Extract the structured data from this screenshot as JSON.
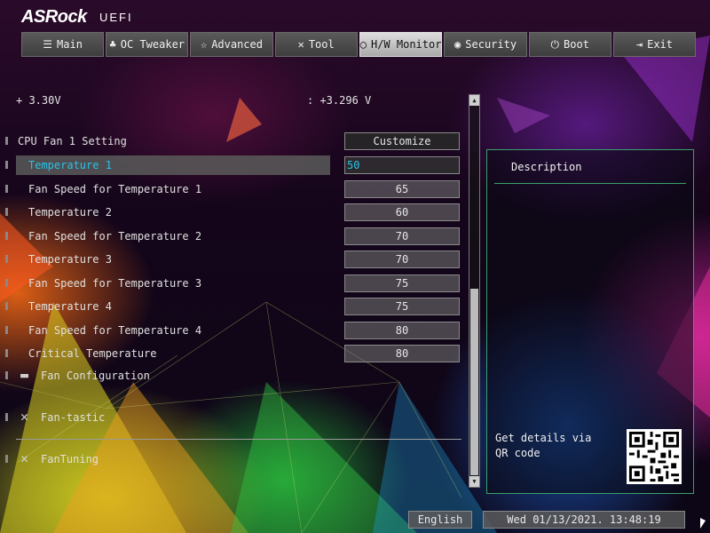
{
  "brand": {
    "logo": "ASRock",
    "tag": "UEFI"
  },
  "tabs": [
    {
      "label": "Main",
      "icon": "list-icon",
      "glyph": "☰"
    },
    {
      "label": "OC Tweaker",
      "icon": "rocket-icon",
      "glyph": "♣"
    },
    {
      "label": "Advanced",
      "icon": "star-icon",
      "glyph": "☆"
    },
    {
      "label": "Tool",
      "icon": "tools-icon",
      "glyph": "✕"
    },
    {
      "label": "H/W Monitor",
      "icon": "monitor-icon",
      "glyph": "◯"
    },
    {
      "label": "Security",
      "icon": "shield-icon",
      "glyph": "◉"
    },
    {
      "label": "Boot",
      "icon": "power-icon",
      "glyph": "⏻"
    },
    {
      "label": "Exit",
      "icon": "exit-icon",
      "glyph": "⇥"
    }
  ],
  "active_tab": "H/W Monitor",
  "voltage": {
    "label": "+ 3.30V",
    "value": ": +3.296 V"
  },
  "settings": [
    {
      "label": "CPU Fan 1 Setting",
      "value": "Customize"
    },
    {
      "label": "Temperature 1",
      "value": "50"
    },
    {
      "label": "Fan Speed for Temperature 1",
      "value": "65"
    },
    {
      "label": "Temperature 2",
      "value": "60"
    },
    {
      "label": "Fan Speed for Temperature 2",
      "value": "70"
    },
    {
      "label": "Temperature 3",
      "value": "70"
    },
    {
      "label": "Fan Speed for Temperature 3",
      "value": "75"
    },
    {
      "label": "Temperature 4",
      "value": "75"
    },
    {
      "label": "Fan Speed for Temperature 4",
      "value": "80"
    },
    {
      "label": "Critical Temperature",
      "value": "80"
    }
  ],
  "submenus": [
    {
      "label": "Fan Configuration",
      "icon": "folder-icon"
    },
    {
      "label": "Fan-tastic",
      "icon": "tools-icon"
    },
    {
      "label": "FanTuning",
      "icon": "tools-icon"
    }
  ],
  "description": {
    "title": "Description",
    "qr_text": "Get details via QR code"
  },
  "footer": {
    "language": "English",
    "datetime": "Wed 01/13/2021. 13:48:19"
  },
  "colors": {
    "accent": "#27c3e6",
    "panel_border": "#3aa06a",
    "active_tab": "#d0d0d0"
  }
}
